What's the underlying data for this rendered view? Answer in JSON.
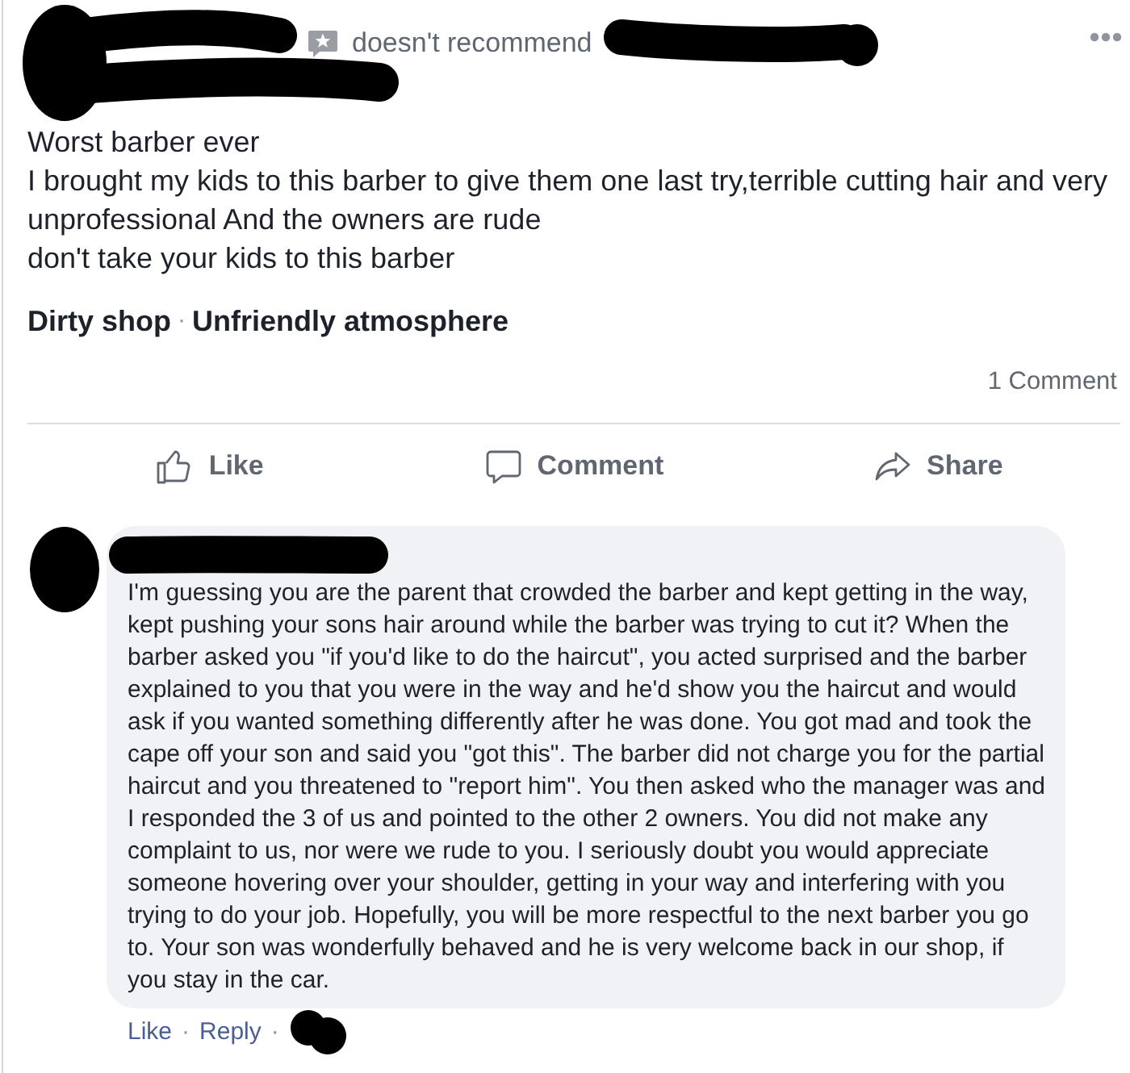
{
  "review": {
    "recommendation": "doesn't recommend",
    "title": "Worst barber ever",
    "body": [
      "I brought my kids to this barber to give them one last try,terrible cutting hair and very unprofessional And the owners are rude",
      "don't take your kids to this barber"
    ],
    "tags": [
      {
        "kind": "tag",
        "text": "Dirty shop"
      },
      {
        "kind": "separator",
        "text": "·"
      },
      {
        "kind": "tag",
        "text": "Unfriendly atmosphere"
      }
    ],
    "comment_count": "1 Comment"
  },
  "actions": [
    {
      "kind": "like",
      "label": "Like"
    },
    {
      "kind": "comment",
      "label": "Comment"
    },
    {
      "kind": "share",
      "label": "Share"
    }
  ],
  "comments": [
    {
      "text": "I'm guessing you are the parent that crowded the barber and kept getting in the way, kept pushing your sons hair around while the barber was trying to cut it? When the barber asked you \"if you'd like to do the haircut\", you acted surprised and the barber explained to you that you were in the way and he'd show you the haircut and would ask if you wanted something differently after he was done. You got mad and took the cape off your son and said you \"got this\". The barber did not charge you for the partial haircut and you threatened to \"report him\". You then asked who the manager was and I responded the 3 of us and pointed to the other 2 owners. You did not make any complaint to us, nor were we rude to you. I seriously doubt you would appreciate someone hovering over your shoulder, getting in your way and interfering with you trying to do your job. Hopefully, you will be more respectful to the next barber you go to. Your son was wonderfully behaved and he is very welcome back in our shop, if you stay in the car.",
      "footer": [
        {
          "kind": "like",
          "text": "Like"
        },
        {
          "kind": "separator",
          "text": "·"
        },
        {
          "kind": "reply",
          "text": "Reply"
        },
        {
          "kind": "separator",
          "text": "·"
        }
      ]
    }
  ]
}
